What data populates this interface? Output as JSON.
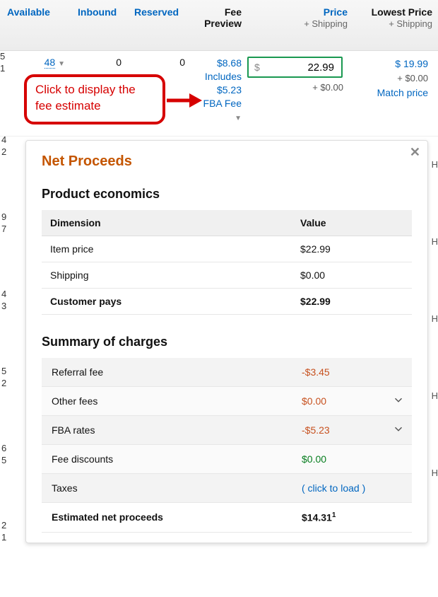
{
  "headers": {
    "available": "Available",
    "inbound": "Inbound",
    "reserved": "Reserved",
    "fee": "Fee Preview",
    "price": "Price",
    "price_sub": "+ Shipping",
    "lowest": "Lowest Price",
    "lowest_sub": "+ Shipping"
  },
  "row": {
    "stub_a": "5",
    "stub_b": "1",
    "available": "48",
    "inbound": "0",
    "reserved": "0",
    "fee_total": "$8.68",
    "fee_inc": "Includes",
    "fee_fba_amt": "$5.23",
    "fee_fba": "FBA Fee",
    "price_input": "22.99",
    "price_ship": "+ $0.00",
    "lowest_price": "$ 19.99",
    "lowest_ship": "+ $0.00",
    "match": "Match price"
  },
  "callout": "Click to display the fee estimate",
  "bg_rows": [
    {
      "a": "4",
      "b": "2"
    },
    {
      "a": "9",
      "b": "7"
    },
    {
      "a": "4",
      "b": "3"
    },
    {
      "a": "5",
      "b": "2"
    },
    {
      "a": "6",
      "b": "5"
    },
    {
      "a": "2",
      "b": "1"
    }
  ],
  "panel": {
    "title": "Net Proceeds",
    "econ_title": "Product economics",
    "dim": "Dimension",
    "val": "Value",
    "econ": [
      {
        "label": "Item price",
        "value": "$22.99"
      },
      {
        "label": "Shipping",
        "value": "$0.00"
      },
      {
        "label": "Customer pays",
        "value": "$22.99"
      }
    ],
    "chg_title": "Summary of charges",
    "charges": [
      {
        "label": "Referral fee",
        "value": "-$3.45",
        "cls": "neg",
        "expand": false
      },
      {
        "label": "Other fees",
        "value": "$0.00",
        "cls": "zero",
        "expand": true
      },
      {
        "label": "FBA rates",
        "value": "-$5.23",
        "cls": "neg",
        "expand": true
      },
      {
        "label": "Fee discounts",
        "value": "$0.00",
        "cls": "pos",
        "expand": false
      },
      {
        "label": "Taxes",
        "value": "( click to load )",
        "cls": "loadlnk",
        "expand": false
      }
    ],
    "net_label": "Estimated net proceeds",
    "net_value": "$14.31",
    "net_sup": "1"
  }
}
